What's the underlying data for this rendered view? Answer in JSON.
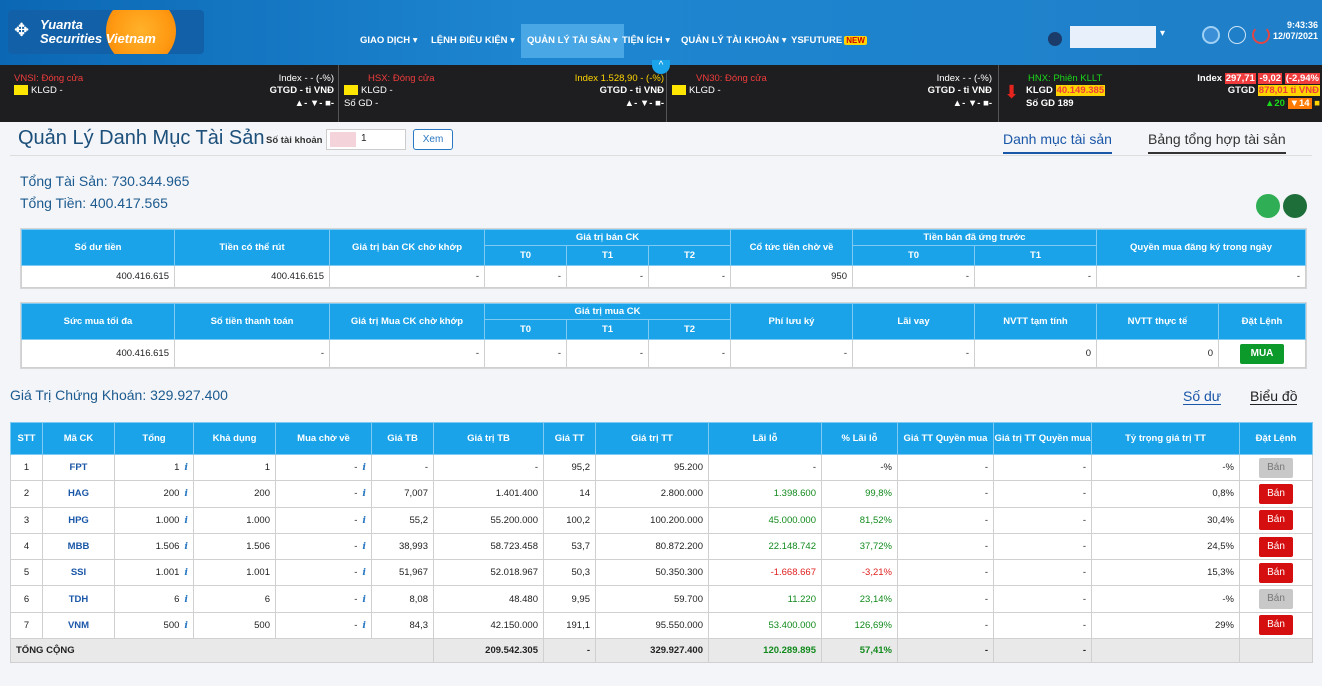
{
  "brand": {
    "line1": "Yuanta",
    "line2": "Securities Vietnam"
  },
  "nav": [
    {
      "label": "GIAO DỊCH ▾"
    },
    {
      "label": "LỆNH ĐIỀU KIỆN ▾"
    },
    {
      "label": "QUẢN LÝ TÀI SẢN ▾"
    },
    {
      "label": "TIỆN ÍCH ▾"
    },
    {
      "label": "QUẢN LÝ TÀI KHOẢN ▾"
    },
    {
      "label": "YSFUTURE",
      "badge": "NEW"
    }
  ],
  "clock": {
    "time": "9:43:36",
    "date": "12/07/2021"
  },
  "ticker": [
    {
      "name": "VNSI:",
      "status": "Đóng cửa",
      "klgd": "KLGD -",
      "index": "Index - - (-%)",
      "gtgd": "GTGD - tỉ VNĐ",
      "arrows": "▲- ▼- ■-"
    },
    {
      "name": "HSX:",
      "status": "Đóng cửa",
      "klgd": "KLGD -",
      "sogd": "Số GD -",
      "index": "Index 1.528,90 - (-%)",
      "gtgd": "GTGD - tỉ VNĐ",
      "arrows": "▲- ▼- ■-"
    },
    {
      "name": "VN30:",
      "status": "Đóng cửa",
      "klgd": "KLGD -",
      "index": "Index - - (-%)",
      "gtgd": "GTGD - tỉ VNĐ",
      "arrows": "▲- ▼- ■-"
    },
    {
      "name": "HNX:",
      "status": "Phiên KLLT",
      "klgd_label": "KLGD",
      "klgd_val": "40.149.385",
      "sogd": "Số GD 189",
      "index_label": "Index",
      "index_val": "297,71",
      "index_chg": "-9,02",
      "index_pct": "(-2,94%",
      "gtgd_label": "GTGD",
      "gtgd_val": "878,01 tỉ VNĐ",
      "up": "▲20",
      "down": "▼14",
      "same": "■"
    }
  ],
  "page": {
    "title": "Quản Lý Danh Mục Tài Sản",
    "account_label": "Số tài khoản",
    "account_value": "1",
    "view_btn": "Xem",
    "tab1": "Danh mục tài sản",
    "tab2": "Bảng tổng hợp tài sản"
  },
  "summary": {
    "total_assets": "Tổng Tài Sản: 730.344.965",
    "total_cash": "Tổng Tiền: 400.417.565"
  },
  "cash_table": {
    "headers": [
      "Số dư tiền",
      "Tiền có thể rút",
      "Giá trị bán CK chờ khớp",
      "Giá trị bán CK",
      "Cổ tức tiền chờ về",
      "Tiền bán đã ứng trước",
      "Quyền mua đăng ký trong ngày"
    ],
    "sub": [
      "T0",
      "T1",
      "T2",
      "T0",
      "T1"
    ],
    "row": [
      "400.416.615",
      "400.416.615",
      "-",
      "-",
      "-",
      "-",
      "950",
      "-",
      "-",
      "-"
    ]
  },
  "buy_table": {
    "headers": [
      "Sức mua tối đa",
      "Số tiền thanh toán",
      "Giá trị Mua CK chờ khớp",
      "Giá trị mua CK",
      "Phí lưu ký",
      "Lãi vay",
      "NVTT tạm tính",
      "NVTT thực tế",
      "Đặt Lệnh"
    ],
    "sub": [
      "T0",
      "T1",
      "T2"
    ],
    "row": [
      "400.416.615",
      "-",
      "-",
      "-",
      "-",
      "-",
      "-",
      "-",
      "0",
      "0"
    ],
    "buy_btn": "MUA"
  },
  "securities": {
    "title": "Giá Trị Chứng Khoán: 329.927.400",
    "tab1": "Số dư",
    "tab2": "Biểu đồ",
    "headers": [
      "STT",
      "Mã CK",
      "Tổng",
      "Khả dụng",
      "Mua chờ về",
      "Giá TB",
      "Giá trị TB",
      "Giá TT",
      "Giá trị TT",
      "Lãi lỗ",
      "% Lãi lỗ",
      "Giá TT Quyền mua",
      "Giá trị TT Quyền mua",
      "Tỷ trọng giá trị TT",
      "Đặt Lệnh"
    ],
    "rows": [
      {
        "stt": "1",
        "code": "FPT",
        "total": "1",
        "avail": "1",
        "pending": "-",
        "avg": "-",
        "avg_val": "-",
        "price": "95,2",
        "mkt_val": "95.200",
        "pl": "-",
        "pl_pct": "-%",
        "r_price": "-",
        "r_val": "-",
        "weight": "-%",
        "sell": "Bán",
        "pl_color": "",
        "sell_enabled": false
      },
      {
        "stt": "2",
        "code": "HAG",
        "total": "200",
        "avail": "200",
        "pending": "-",
        "avg": "7,007",
        "avg_val": "1.401.400",
        "price": "14",
        "mkt_val": "2.800.000",
        "pl": "1.398.600",
        "pl_pct": "99,8%",
        "r_price": "-",
        "r_val": "-",
        "weight": "0,8%",
        "sell": "Bán",
        "pl_color": "g",
        "sell_enabled": true
      },
      {
        "stt": "3",
        "code": "HPG",
        "total": "1.000",
        "avail": "1.000",
        "pending": "-",
        "avg": "55,2",
        "avg_val": "55.200.000",
        "price": "100,2",
        "mkt_val": "100.200.000",
        "pl": "45.000.000",
        "pl_pct": "81,52%",
        "r_price": "-",
        "r_val": "-",
        "weight": "30,4%",
        "sell": "Bán",
        "pl_color": "g",
        "sell_enabled": true
      },
      {
        "stt": "4",
        "code": "MBB",
        "total": "1.506",
        "avail": "1.506",
        "pending": "-",
        "avg": "38,993",
        "avg_val": "58.723.458",
        "price": "53,7",
        "mkt_val": "80.872.200",
        "pl": "22.148.742",
        "pl_pct": "37,72%",
        "r_price": "-",
        "r_val": "-",
        "weight": "24,5%",
        "sell": "Bán",
        "pl_color": "g",
        "sell_enabled": true
      },
      {
        "stt": "5",
        "code": "SSI",
        "total": "1.001",
        "avail": "1.001",
        "pending": "-",
        "avg": "51,967",
        "avg_val": "52.018.967",
        "price": "50,3",
        "mkt_val": "50.350.300",
        "pl": "-1.668.667",
        "pl_pct": "-3,21%",
        "r_price": "-",
        "r_val": "-",
        "weight": "15,3%",
        "sell": "Bán",
        "pl_color": "r",
        "sell_enabled": true
      },
      {
        "stt": "6",
        "code": "TDH",
        "total": "6",
        "avail": "6",
        "pending": "-",
        "avg": "8,08",
        "avg_val": "48.480",
        "price": "9,95",
        "mkt_val": "59.700",
        "pl": "11.220",
        "pl_pct": "23,14%",
        "r_price": "-",
        "r_val": "-",
        "weight": "-%",
        "sell": "Bán",
        "pl_color": "g",
        "sell_enabled": false
      },
      {
        "stt": "7",
        "code": "VNM",
        "total": "500",
        "avail": "500",
        "pending": "-",
        "avg": "84,3",
        "avg_val": "42.150.000",
        "price": "191,1",
        "mkt_val": "95.550.000",
        "pl": "53.400.000",
        "pl_pct": "126,69%",
        "r_price": "-",
        "r_val": "-",
        "weight": "29%",
        "sell": "Bán",
        "pl_color": "g",
        "sell_enabled": true
      }
    ],
    "total": {
      "label": "TỔNG CỘNG",
      "avg_val": "209.542.305",
      "price": "-",
      "mkt_val": "329.927.400",
      "pl": "120.289.895",
      "pl_pct": "57,41%",
      "r_price": "-",
      "r_val": "-"
    }
  },
  "colors": {
    "header_blue": "#1aa3e8",
    "buy_green": "#0c9a2a",
    "sell_red": "#d50f0f",
    "profit_green": "#118a1c",
    "loss_red": "#e01e1e"
  }
}
